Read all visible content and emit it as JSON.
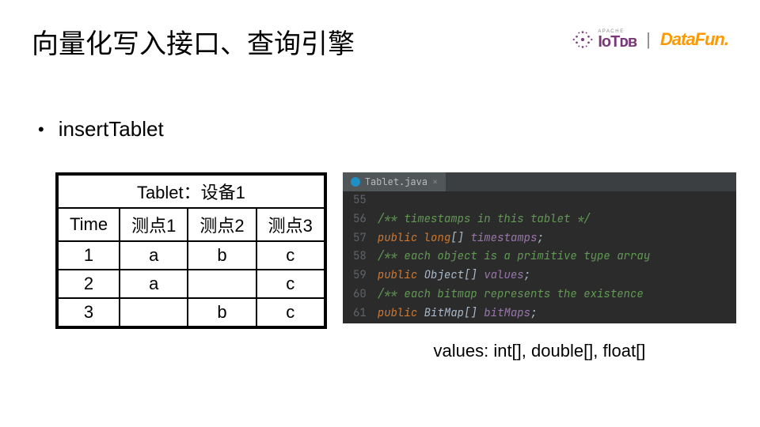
{
  "title": "向量化写入接口、查询引擎",
  "logos": {
    "iotdb": "IᴏTᴅʙ",
    "apache": "A P A C H E",
    "datafun": "DataFun."
  },
  "bullet": "insertTablet",
  "table": {
    "caption": "Tablet：设备1",
    "headers": [
      "Time",
      "测点1",
      "测点2",
      "测点3"
    ],
    "rows": [
      [
        "1",
        "a",
        "b",
        "c"
      ],
      [
        "2",
        "a",
        "",
        "c"
      ],
      [
        "3",
        "",
        "b",
        "c"
      ]
    ]
  },
  "editor": {
    "filename": "Tablet.java",
    "lines": [
      {
        "n": 55,
        "kind": "blank"
      },
      {
        "n": 56,
        "kind": "comment",
        "text": "/** timestamps in this tablet */"
      },
      {
        "n": 57,
        "kind": "decl",
        "kw": "public",
        "type": "long",
        "arr": "[]",
        "name": "timestamps"
      },
      {
        "n": 58,
        "kind": "comment",
        "text": "/** each object is a primitive type array"
      },
      {
        "n": 59,
        "kind": "decl",
        "kw": "public",
        "type": "Object",
        "arr": "[]",
        "name": "values"
      },
      {
        "n": 60,
        "kind": "comment",
        "text": "/** each bitmap represents the existence"
      },
      {
        "n": 61,
        "kind": "decl",
        "kw": "public",
        "type": "BitMap",
        "arr": "[]",
        "name": "bitMaps"
      }
    ]
  },
  "values_note": "values: int[], double[], float[]"
}
